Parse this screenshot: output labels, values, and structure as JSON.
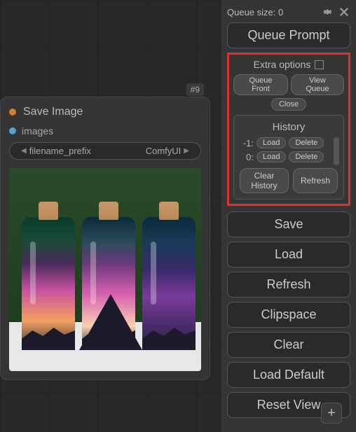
{
  "node": {
    "badge": "#9",
    "title": "Save Image",
    "input_label": "images",
    "field_label": "filename_prefix",
    "field_value": "ComfyUI"
  },
  "sidebar": {
    "queue_size_label": "Queue size: 0",
    "queue_prompt": "Queue Prompt",
    "extra_options": "Extra options",
    "queue_front": "Queue Front",
    "view_queue": "View Queue",
    "close": "Close",
    "history": {
      "title": "History",
      "items": [
        {
          "idx": "-1:",
          "load": "Load",
          "delete": "Delete"
        },
        {
          "idx": "0:",
          "load": "Load",
          "delete": "Delete"
        }
      ],
      "clear": "Clear History",
      "refresh": "Refresh"
    },
    "buttons": {
      "save": "Save",
      "load": "Load",
      "refresh": "Refresh",
      "clipspace": "Clipspace",
      "clear": "Clear",
      "load_default": "Load Default",
      "reset_view": "Reset View"
    }
  }
}
